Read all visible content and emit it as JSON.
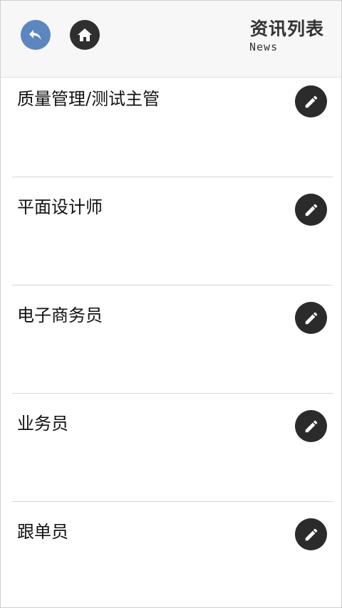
{
  "header": {
    "title": "资讯列表",
    "subtitle": "News",
    "back_icon": "back-arrow-icon",
    "home_icon": "home-icon"
  },
  "colors": {
    "back_button": "#5b86bf",
    "home_button": "#2f2f2f",
    "edit_button": "#2b2b2b"
  },
  "items": [
    {
      "title": "质量管理/测试主管",
      "icon": "edit-pencil-icon"
    },
    {
      "title": "平面设计师",
      "icon": "edit-pencil-icon"
    },
    {
      "title": "电子商务员",
      "icon": "edit-pencil-icon"
    },
    {
      "title": "业务员",
      "icon": "edit-pencil-icon"
    },
    {
      "title": "跟单员",
      "icon": "edit-pencil-icon"
    }
  ]
}
